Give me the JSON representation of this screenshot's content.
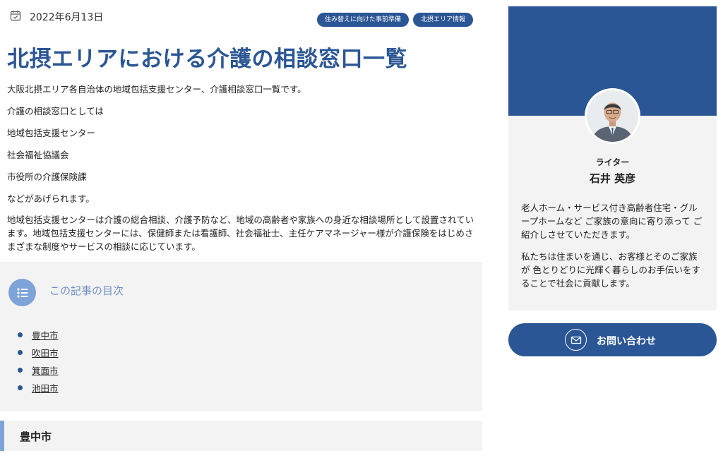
{
  "article": {
    "date": "2022年6月13日",
    "date_icon": "calendar-icon",
    "tags": [
      "住み替えに向けた事前準備",
      "北摂エリア情報"
    ],
    "title": "北摂エリアにおける介護の相談窓口一覧",
    "paragraphs": [
      "大阪北摂エリア各自治体の地域包括支援センター、介護相談窓口一覧です。",
      "介護の相談窓口としては",
      "地域包括支援センター",
      "社会福祉協議会",
      "市役所の介護保険課",
      "などがあげられます。",
      "地域包括支援センターは介護の総合相談、介護予防など、地域の高齢者や家族への身近な相談場所として設置されています。地域包括支援センターには、保健師または看護師、社会福祉士、主任ケアマネージャー様が介護保険をはじめさまざまな制度やサービスの相談に応じています。"
    ]
  },
  "toc": {
    "icon": "list-icon",
    "title": "この記事の目次",
    "items": [
      "豊中市",
      "吹田市",
      "箕面市",
      "池田市"
    ]
  },
  "section": {
    "heading": "豊中市"
  },
  "sidebar": {
    "role": "ライター",
    "name": "石井 英彦",
    "bio": [
      "老人ホーム・サービス付き高齢者住宅・グループホームなど ご家族の意向に寄り添って ご紹介しさせていただきます。",
      "私たちは住まいを通じ、お客様とそのご家族が 色とりどりに光輝く暮らしのお手伝いをすることで社会に貢献します。"
    ],
    "contact_label": "お問い合わせ",
    "contact_icon": "mail-icon"
  },
  "colors": {
    "brand_blue": "#2b5695",
    "accent_light_blue": "#7ea3d8",
    "panel_gray": "#f3f3f3"
  }
}
